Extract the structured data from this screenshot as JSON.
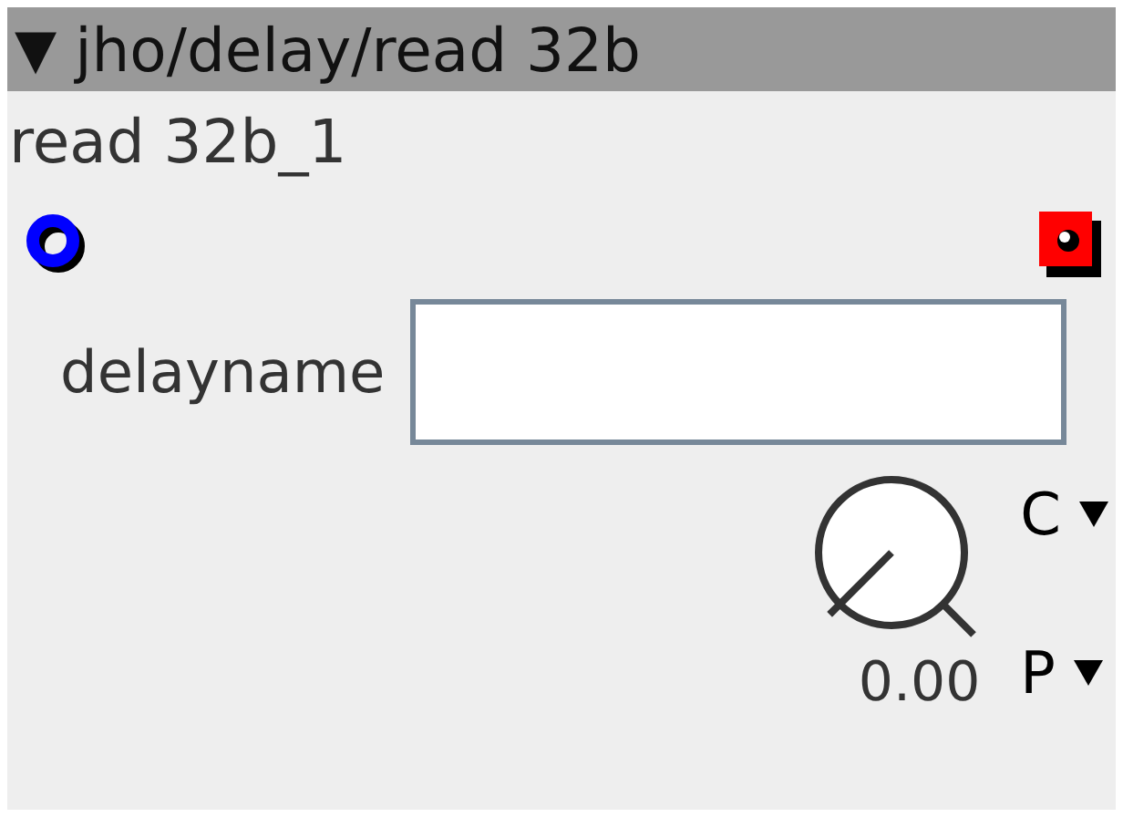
{
  "object": {
    "title_marker": "▼",
    "type": "jho/delay/read 32b",
    "instance_name": "read 32b_1"
  },
  "attribute": {
    "label": "delayname"
  },
  "dial": {
    "reading": "0.00",
    "buttons": [
      {
        "label": "C"
      },
      {
        "label": "P"
      }
    ]
  }
}
